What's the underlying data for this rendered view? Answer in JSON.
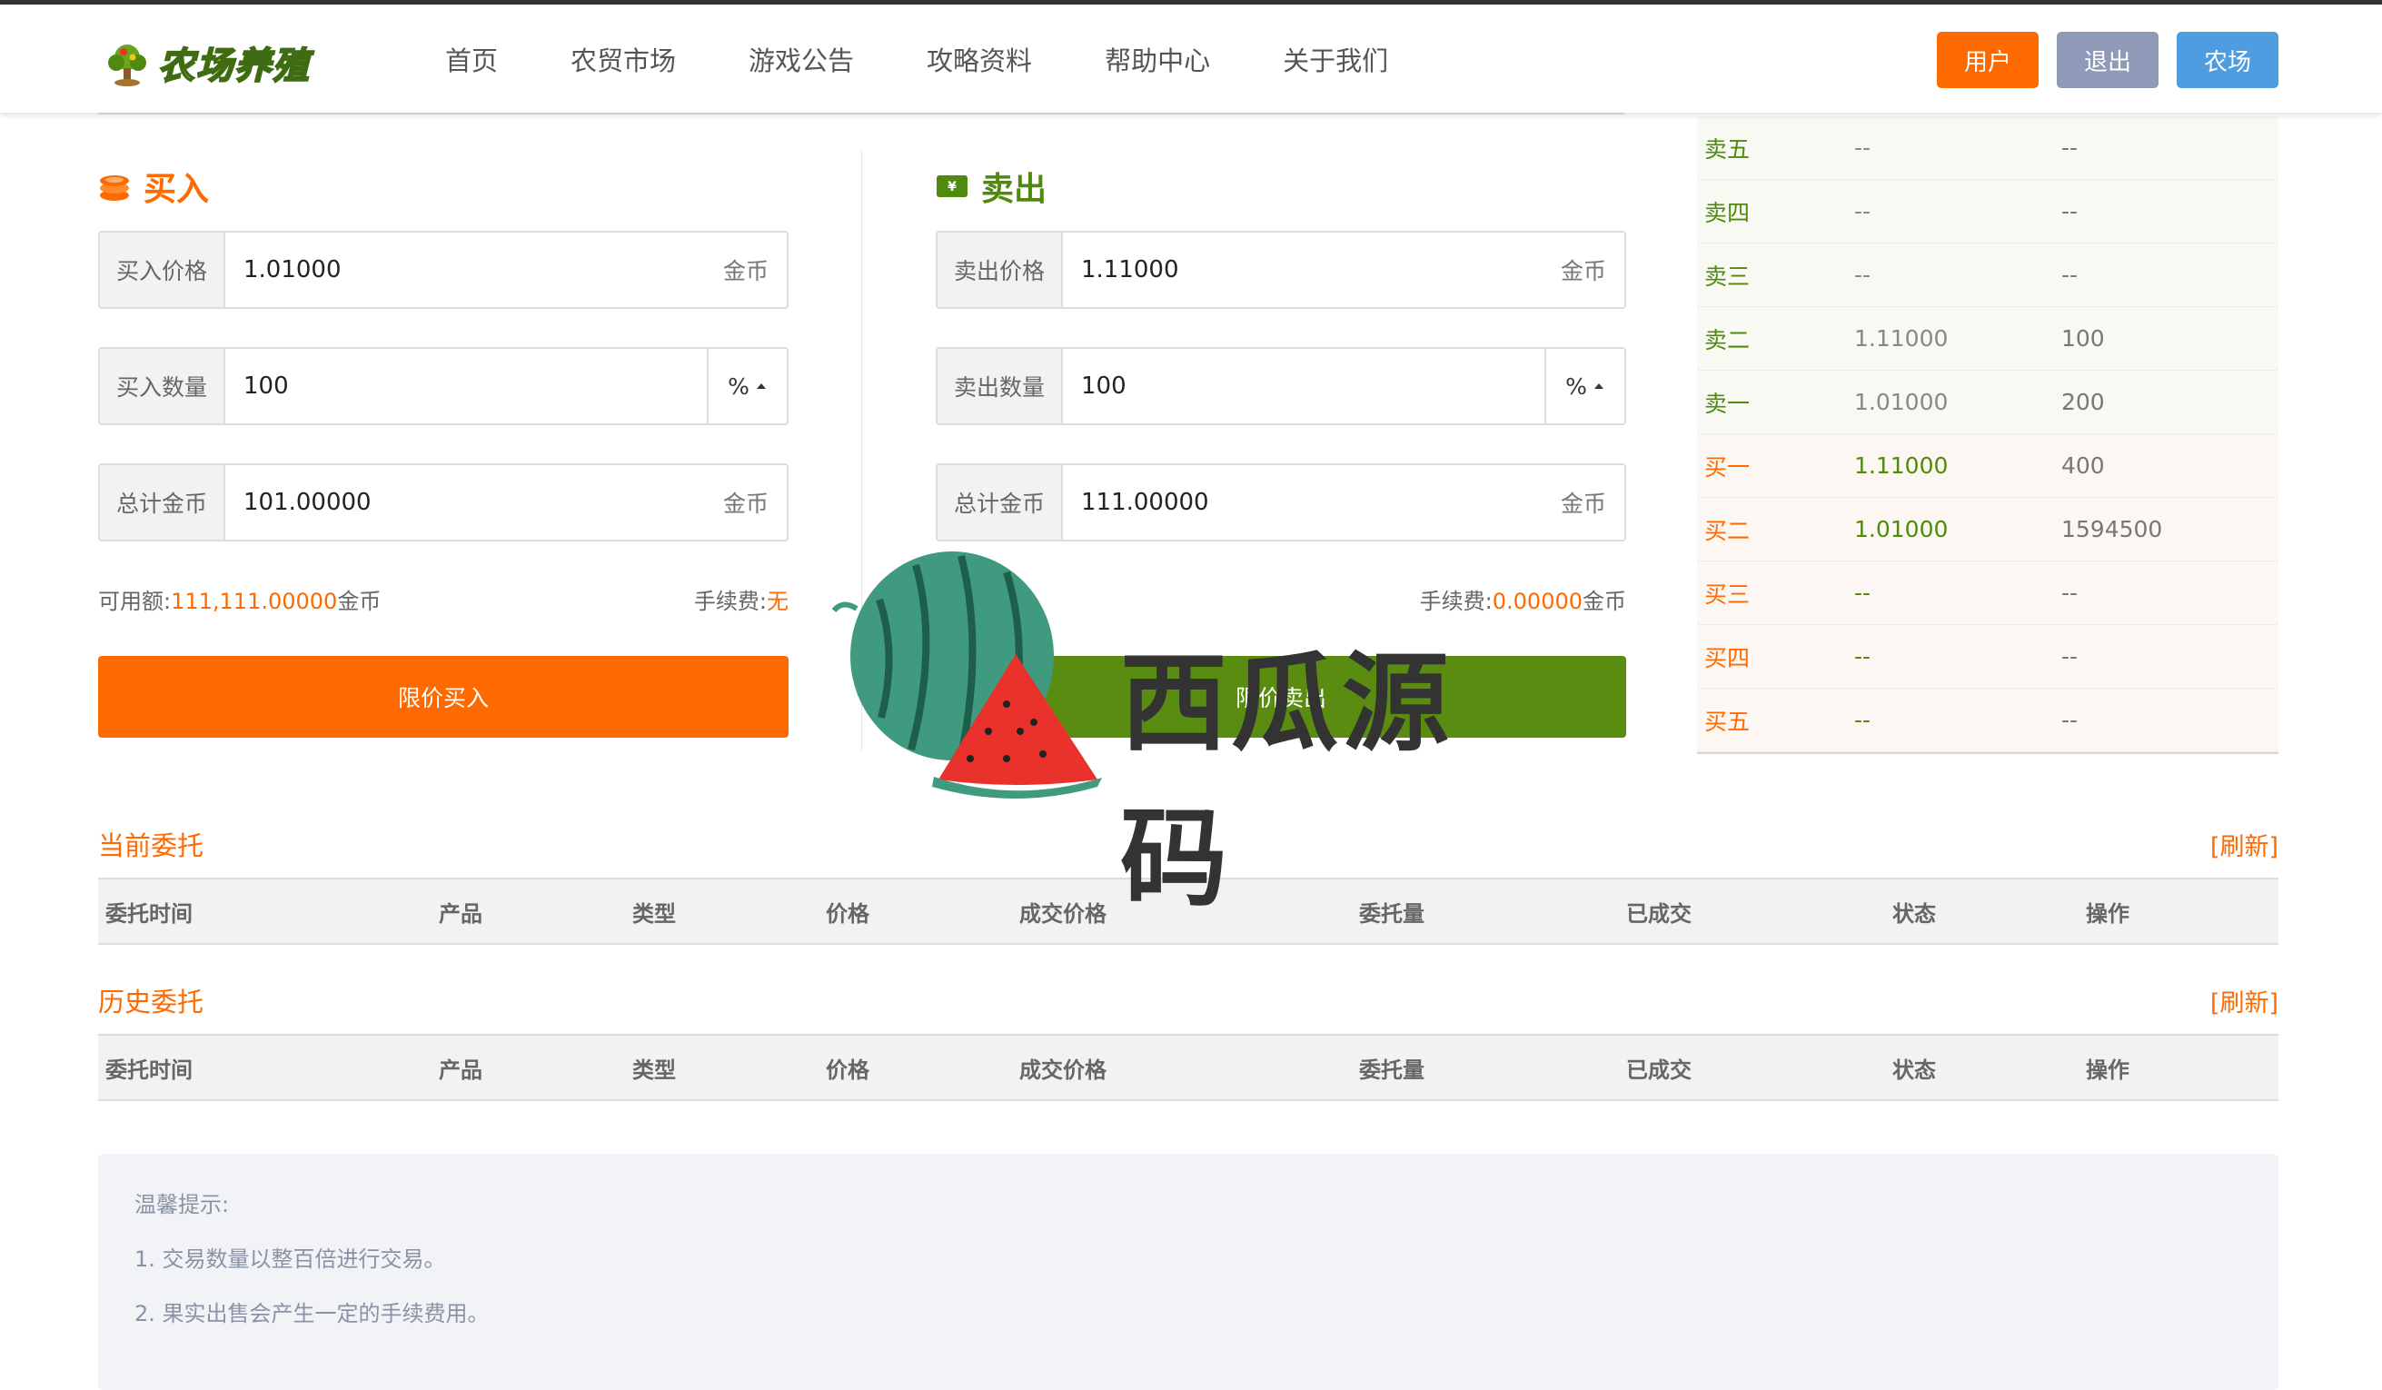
{
  "header": {
    "logo_text": "农场养殖",
    "nav": [
      "首页",
      "农贸市场",
      "游戏公告",
      "攻略资料",
      "帮助中心",
      "关于我们"
    ],
    "buttons": {
      "user": "用户",
      "logout": "退出",
      "farm": "农场"
    }
  },
  "buy": {
    "title": "买入",
    "price_label": "买入价格",
    "price_value": "1.01000",
    "price_unit": "金币",
    "qty_label": "买入数量",
    "qty_value": "100",
    "qty_pct": "%",
    "total_label": "总计金币",
    "total_value": "101.00000",
    "total_unit": "金币",
    "available_label": "可用额:",
    "available_value": "111,111.00000",
    "available_unit": "金币",
    "fee_label": "手续费:",
    "fee_value": "无",
    "button": "限价买入"
  },
  "sell": {
    "title": "卖出",
    "price_label": "卖出价格",
    "price_value": "1.11000",
    "price_unit": "金币",
    "qty_label": "卖出数量",
    "qty_value": "100",
    "qty_pct": "%",
    "total_label": "总计金币",
    "total_value": "111.00000",
    "total_unit": "金币",
    "fee_label": "手续费:",
    "fee_value": "0.00000",
    "fee_unit": "金币",
    "button": "限价卖出"
  },
  "order_book": [
    {
      "side": "sell",
      "label": "卖五",
      "price": "--",
      "qty": "--"
    },
    {
      "side": "sell",
      "label": "卖四",
      "price": "--",
      "qty": "--"
    },
    {
      "side": "sell",
      "label": "卖三",
      "price": "--",
      "qty": "--"
    },
    {
      "side": "sell",
      "label": "卖二",
      "price": "1.11000",
      "qty": "100"
    },
    {
      "side": "sell",
      "label": "卖一",
      "price": "1.01000",
      "qty": "200"
    },
    {
      "side": "buy",
      "label": "买一",
      "price": "1.11000",
      "qty": "400"
    },
    {
      "side": "buy",
      "label": "买二",
      "price": "1.01000",
      "qty": "1594500"
    },
    {
      "side": "buy",
      "label": "买三",
      "price": "--",
      "qty": "--"
    },
    {
      "side": "buy",
      "label": "买四",
      "price": "--",
      "qty": "--"
    },
    {
      "side": "buy",
      "label": "买五",
      "price": "--",
      "qty": "--"
    }
  ],
  "current_orders": {
    "title": "当前委托",
    "refresh": "[刷新]"
  },
  "history_orders": {
    "title": "历史委托",
    "refresh": "[刷新]"
  },
  "table_columns": [
    "委托时间",
    "产品",
    "类型",
    "价格",
    "成交价格",
    "委托量",
    "已成交",
    "状态",
    "操作"
  ],
  "tips": {
    "title": "温馨提示:",
    "items": [
      "1. 交易数量以整百倍进行交易。",
      "2. 果实出售会产生一定的手续费用。"
    ]
  },
  "watermark": {
    "text": "西瓜源码"
  },
  "colors": {
    "accent": "#ff6a00",
    "green": "#5a8c12",
    "logout": "#8e9ab8",
    "farm": "#4f9de1"
  }
}
